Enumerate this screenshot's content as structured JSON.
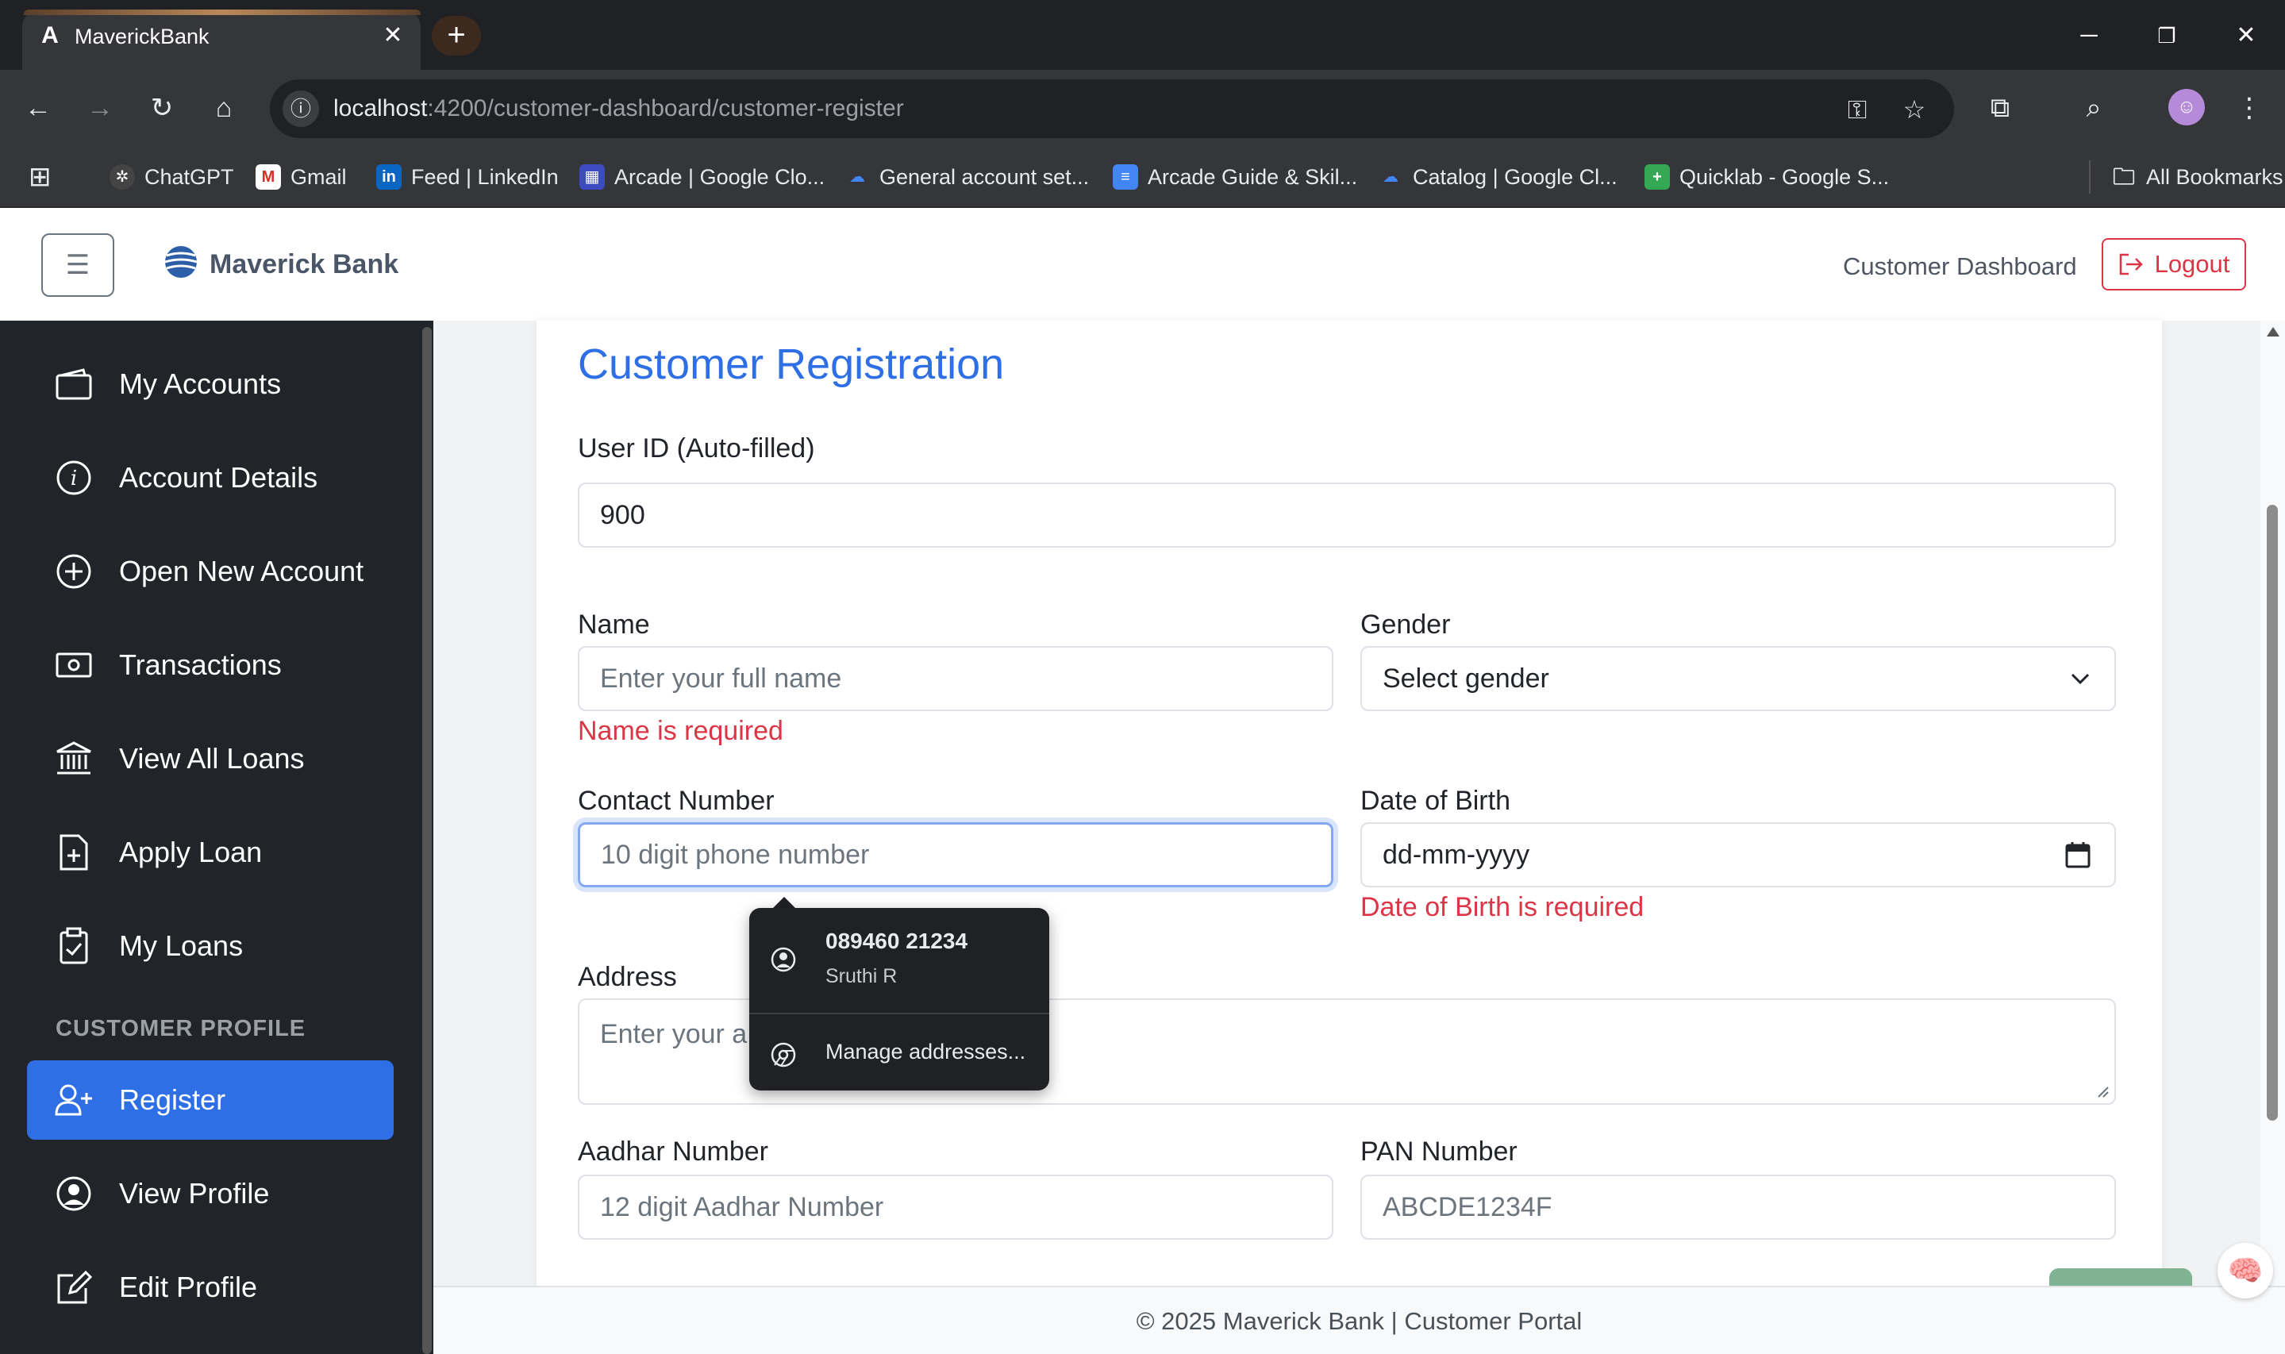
{
  "browser": {
    "tab_title": "MaverickBank",
    "tab_favicon": "A",
    "url_host": "localhost",
    "url_path": ":4200/customer-dashboard/customer-register",
    "bookmarks": [
      {
        "label": "ChatGPT"
      },
      {
        "label": "Gmail"
      },
      {
        "label": "Feed | LinkedIn"
      },
      {
        "label": "Arcade | Google Clo..."
      },
      {
        "label": "General account set..."
      },
      {
        "label": "Arcade Guide & Skil..."
      },
      {
        "label": "Catalog | Google Cl..."
      },
      {
        "label": "Quicklab - Google S..."
      },
      {
        "label": "All Bookmarks"
      }
    ]
  },
  "header": {
    "brand": "Maverick Bank",
    "nav_link": "Customer Dashboard",
    "logout_label": "Logout"
  },
  "sidebar": {
    "items": [
      {
        "label": "My Accounts",
        "icon": "wallet-icon"
      },
      {
        "label": "Account Details",
        "icon": "info-circle-icon"
      },
      {
        "label": "Open New Account",
        "icon": "plus-circle-icon"
      },
      {
        "label": "Transactions",
        "icon": "cash-icon"
      },
      {
        "label": "View All Loans",
        "icon": "bank-icon"
      },
      {
        "label": "Apply Loan",
        "icon": "file-plus-icon"
      },
      {
        "label": "My Loans",
        "icon": "clipboard-check-icon"
      }
    ],
    "section_title": "CUSTOMER PROFILE",
    "profile_items": [
      {
        "label": "Register",
        "icon": "person-plus-icon",
        "active": true
      },
      {
        "label": "View Profile",
        "icon": "person-circle-icon"
      },
      {
        "label": "Edit Profile",
        "icon": "pencil-square-icon"
      }
    ]
  },
  "form": {
    "title": "Customer Registration",
    "user_id_label": "User ID (Auto-filled)",
    "user_id_value": "900",
    "name_label": "Name",
    "name_placeholder": "Enter your full name",
    "name_error": "Name is required",
    "gender_label": "Gender",
    "gender_value": "Select gender",
    "contact_label": "Contact Number",
    "contact_placeholder": "10 digit phone number",
    "dob_label": "Date of Birth",
    "dob_placeholder": "dd-mm-yyyy",
    "dob_error": "Date of Birth is required",
    "address_label": "Address",
    "address_placeholder": "Enter your a",
    "aadhar_label": "Aadhar Number",
    "aadhar_placeholder": "12 digit Aadhar Number",
    "pan_label": "PAN Number",
    "pan_placeholder": "ABCDE1234F"
  },
  "autofill": {
    "phone": "089460 21234",
    "name": "Sruthi R",
    "manage_label": "Manage addresses..."
  },
  "footer": {
    "text": "© 2025 Maverick Bank | Customer Portal"
  },
  "colors": {
    "accent": "#2e6fe6",
    "sidebar_bg": "#212529",
    "error": "#dc3545"
  }
}
